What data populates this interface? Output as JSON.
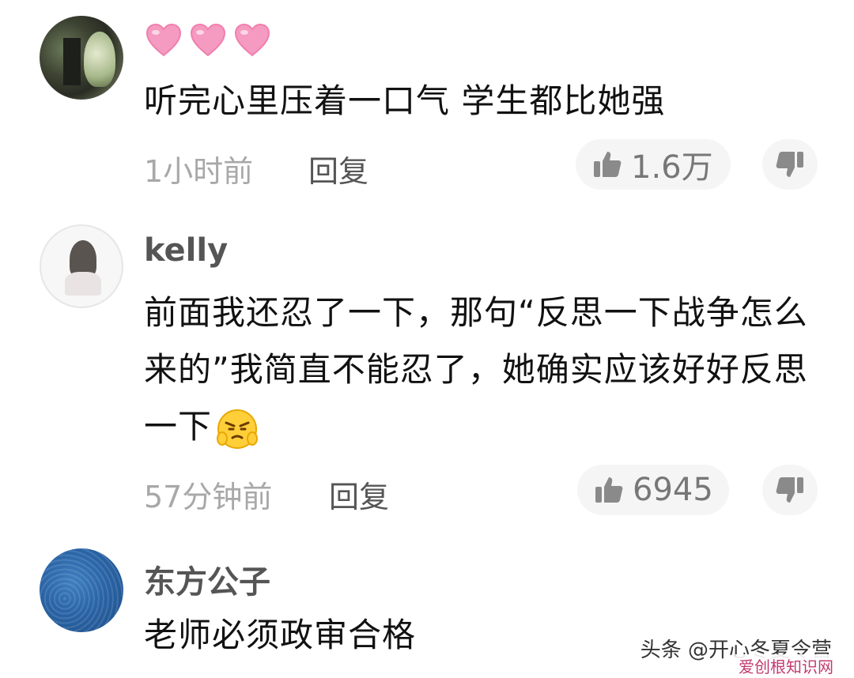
{
  "comments": [
    {
      "name": "",
      "reaction_hearts": [
        "pink-heart",
        "pink-heart",
        "pink-heart"
      ],
      "text": "听完心里压着一口气 学生都比她强",
      "time": "1小时前",
      "reply_label": "回复",
      "likes": "1.6万"
    },
    {
      "name": "kelly",
      "text": "前面我还忍了一下，那句“反思一下战争怎么来的”我简直不能忍了，她确实应该好好反思一下",
      "emoji": "angry-face-emoji",
      "time": "57分钟前",
      "reply_label": "回复",
      "likes": "6945"
    },
    {
      "name": "东方公子",
      "text": "老师必须政审合格"
    }
  ],
  "watermark": {
    "text": "头条 @开心冬夏令营",
    "sub": "爱创根知识网"
  },
  "colors": {
    "text": "#111111",
    "meta": "#a8a8a8",
    "pill_bg": "#f5f5f5",
    "heart": "#f59ac0"
  }
}
